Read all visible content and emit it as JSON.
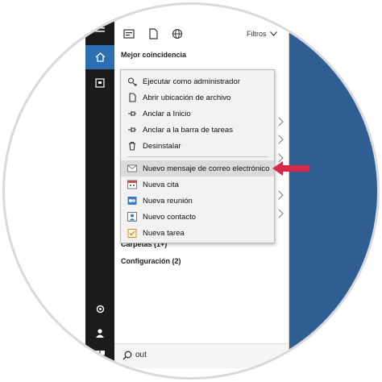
{
  "panel": {
    "filters_label": "Filtros",
    "best_match_title": "Mejor coincidencia",
    "carpetas_partial": "Carpetas (1+)",
    "configuracion": "Configuración (2)"
  },
  "context_menu": {
    "items": [
      {
        "label": "Ejecutar como administrador",
        "icon": "run-as-admin-icon"
      },
      {
        "label": "Abrir ubicación de archivo",
        "icon": "file-icon"
      },
      {
        "label": "Anclar a Inicio",
        "icon": "pin-icon"
      },
      {
        "label": "Anclar a la barra de tareas",
        "icon": "pin-icon"
      },
      {
        "label": "Desinstalar",
        "icon": "trash-icon"
      },
      {
        "label": "Nuevo mensaje de correo electrónico",
        "icon": "envelope-icon",
        "highlighted": true
      },
      {
        "label": "Nueva cita",
        "icon": "calendar-icon"
      },
      {
        "label": "Nueva reunión",
        "icon": "meeting-icon"
      },
      {
        "label": "Nuevo contacto",
        "icon": "contact-icon"
      },
      {
        "label": "Nueva tarea",
        "icon": "task-icon"
      }
    ]
  },
  "search": {
    "query": "out"
  },
  "colors": {
    "sidebar": "#1b1b1b",
    "home_accent": "#2b6fb0",
    "desktop": "#2f5e93",
    "arrow": "#d9294a"
  }
}
